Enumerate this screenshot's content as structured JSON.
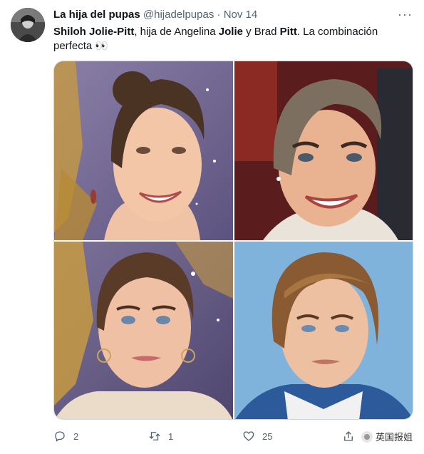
{
  "tweet": {
    "display_name": "La hija del pupas",
    "handle": "@hijadelpupas",
    "separator": "·",
    "date": "Nov 14",
    "more_label": "···",
    "text_segments": {
      "s1": "Shiloh Jolie-Pitt",
      "s2": ", hija de Angelina ",
      "s3": "Jolie",
      "s4": " y Brad ",
      "s5": "Pitt",
      "s6": ". La combinación perfecta ",
      "s7": "👀"
    },
    "images": [
      {
        "icon": "portrait-young-woman-smiling"
      },
      {
        "icon": "portrait-woman-smiling"
      },
      {
        "icon": "portrait-young-woman-earrings"
      },
      {
        "icon": "portrait-young-man"
      }
    ],
    "actions": {
      "reply_count": "2",
      "retweet_count": "1",
      "like_count": "25"
    },
    "watermark": "英国报姐"
  },
  "colors": {
    "text": "#0f1419",
    "muted": "#536471",
    "border": "#cfd9de"
  }
}
